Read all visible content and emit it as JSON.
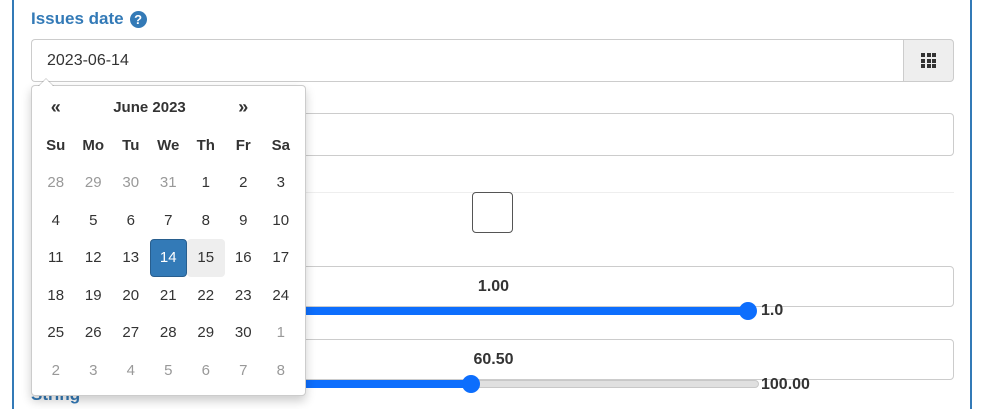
{
  "form": {
    "issues_date_label": "Issues date",
    "help_icon_glyph": "?",
    "date_value": "2023-06-14",
    "string_label": "String"
  },
  "sliders": [
    {
      "value_text": "1.00",
      "max_text": "1.0",
      "fraction": 1.0
    },
    {
      "value_text": "60.50",
      "max_text": "100.00",
      "fraction": 0.605
    }
  ],
  "datepicker": {
    "prev": "«",
    "next": "»",
    "month_label": "June 2023",
    "weekdays": [
      "Su",
      "Mo",
      "Tu",
      "We",
      "Th",
      "Fr",
      "Sa"
    ],
    "weeks": [
      [
        {
          "d": "28",
          "s": "old"
        },
        {
          "d": "29",
          "s": "old"
        },
        {
          "d": "30",
          "s": "old"
        },
        {
          "d": "31",
          "s": "old"
        },
        {
          "d": "1",
          "s": ""
        },
        {
          "d": "2",
          "s": ""
        },
        {
          "d": "3",
          "s": ""
        }
      ],
      [
        {
          "d": "4",
          "s": ""
        },
        {
          "d": "5",
          "s": ""
        },
        {
          "d": "6",
          "s": ""
        },
        {
          "d": "7",
          "s": ""
        },
        {
          "d": "8",
          "s": ""
        },
        {
          "d": "9",
          "s": ""
        },
        {
          "d": "10",
          "s": ""
        }
      ],
      [
        {
          "d": "11",
          "s": ""
        },
        {
          "d": "12",
          "s": ""
        },
        {
          "d": "13",
          "s": ""
        },
        {
          "d": "14",
          "s": "active"
        },
        {
          "d": "15",
          "s": "today"
        },
        {
          "d": "16",
          "s": ""
        },
        {
          "d": "17",
          "s": ""
        }
      ],
      [
        {
          "d": "18",
          "s": ""
        },
        {
          "d": "19",
          "s": ""
        },
        {
          "d": "20",
          "s": ""
        },
        {
          "d": "21",
          "s": ""
        },
        {
          "d": "22",
          "s": ""
        },
        {
          "d": "23",
          "s": ""
        },
        {
          "d": "24",
          "s": ""
        }
      ],
      [
        {
          "d": "25",
          "s": ""
        },
        {
          "d": "26",
          "s": ""
        },
        {
          "d": "27",
          "s": ""
        },
        {
          "d": "28",
          "s": ""
        },
        {
          "d": "29",
          "s": ""
        },
        {
          "d": "30",
          "s": ""
        },
        {
          "d": "1",
          "s": "old"
        }
      ],
      [
        {
          "d": "2",
          "s": "old"
        },
        {
          "d": "3",
          "s": "old"
        },
        {
          "d": "4",
          "s": "old"
        },
        {
          "d": "5",
          "s": "old"
        },
        {
          "d": "6",
          "s": "old"
        },
        {
          "d": "7",
          "s": "old"
        },
        {
          "d": "8",
          "s": "old"
        }
      ]
    ]
  },
  "colors": {
    "accent": "#337ab7",
    "slider_fill": "#0d6efd",
    "muted_day": "#999999"
  }
}
